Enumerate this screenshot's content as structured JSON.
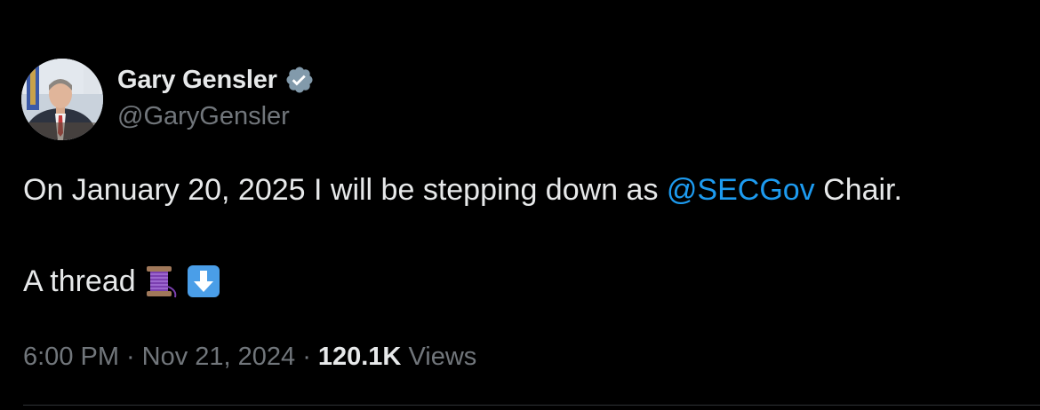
{
  "author": {
    "display_name": "Gary Gensler",
    "handle": "@GaryGensler",
    "verified_icon": "verified-badge-icon",
    "avatar_icon": "profile-photo"
  },
  "tweet": {
    "text_before_mention": "On January 20, 2025 I will be stepping down as ",
    "mention": "@SECGov",
    "text_after_mention": " Chair.",
    "line2_text": "A thread",
    "emojis": [
      "thread-spool-emoji",
      "down-arrow-emoji"
    ]
  },
  "meta": {
    "time": "6:00 PM",
    "date": "Nov 21, 2024",
    "views_count": "120.1K",
    "views_label": "Views",
    "separator": "·"
  },
  "colors": {
    "background": "#000000",
    "text_primary": "#e7e9ea",
    "text_secondary": "#71767b",
    "link": "#1d9bf0"
  }
}
